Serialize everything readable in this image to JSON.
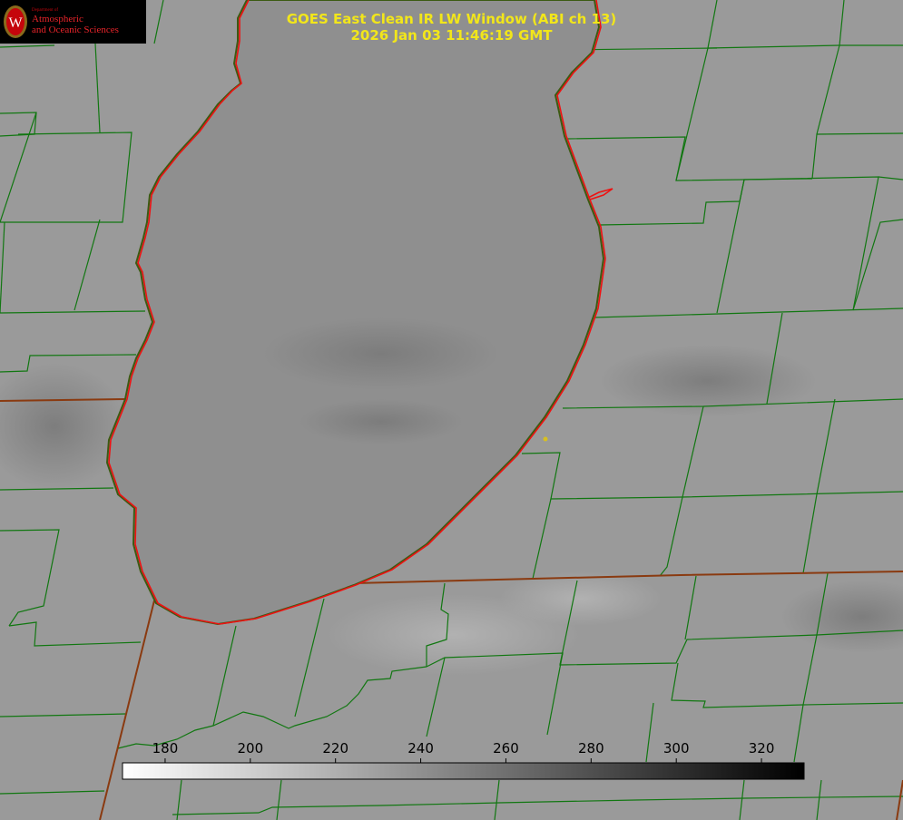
{
  "header": {
    "title": "GOES East Clean IR LW Window (ABI ch 13)",
    "timestamp": "2026 Jan 03 11:46:19 GMT",
    "title_color": "#f2e61a"
  },
  "logo": {
    "department": "Department of",
    "line1": "Atmospheric",
    "line2": "and Oceanic Sciences",
    "seal_letter": "W",
    "text_color": "#e8242a"
  },
  "map_style": {
    "county_line_color": "#117711",
    "state_line_color": "#8a3a10",
    "lake_outline_color": "#ee1111",
    "marker_color": "#d8c020"
  },
  "colorbar": {
    "ticks": [
      "180",
      "200",
      "220",
      "240",
      "260",
      "280",
      "300",
      "320"
    ],
    "range": [
      170,
      330
    ],
    "scale": "white (cold) to black (warm)"
  }
}
